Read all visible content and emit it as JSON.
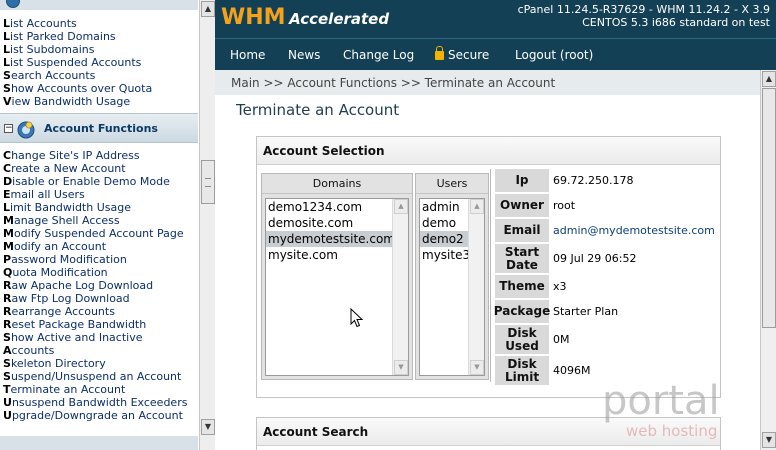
{
  "header": {
    "logo_whm": "WHM",
    "logo_accelerated": "Accelerated",
    "version_line1": "cPanel 11.24.5-R37629 - WHM 11.24.2 - X 3.9",
    "version_line2": "CENTOS 5.3 i686 standard on test"
  },
  "nav": {
    "home": "Home",
    "news": "News",
    "changelog": "Change Log",
    "secure": "Secure",
    "logout": "Logout (root)"
  },
  "sidebar": {
    "top_links": [
      "List Accounts",
      "List Parked Domains",
      "List Subdomains",
      "List Suspended Accounts",
      "Search Accounts",
      "Show Accounts over Quota",
      "View Bandwidth Usage"
    ],
    "section_title": "Account Functions",
    "section_toggle": "−",
    "section_links": [
      "Change Site's IP Address",
      "Create a New Account",
      "Disable or Enable Demo Mode",
      "Email all Users",
      "Limit Bandwidth Usage",
      "Manage Shell Access",
      "Modify Suspended Account Page",
      "Modify an Account",
      "Password Modification",
      "Quota Modification",
      "Raw Apache Log Download",
      "Raw Ftp Log Download",
      "Rearrange Accounts",
      "Reset Package Bandwidth",
      "Show Active and Inactive",
      "Accounts",
      "Skeleton Directory",
      "Suspend/Unsuspend an Account",
      "Terminate an Account",
      "Unsuspend Bandwidth Exceeders",
      "Upgrade/Downgrade an Account"
    ]
  },
  "main": {
    "breadcrumb": "Main >> Account Functions >> Terminate an Account",
    "page_title": "Terminate an Account",
    "selection_panel_title": "Account Selection",
    "domains_header": "Domains",
    "users_header": "Users",
    "domains": [
      "demo1234.com",
      "demosite.com",
      "mydemotestsite.com",
      "mysite.com"
    ],
    "users": [
      "admin",
      "demo",
      "demo2",
      "mysite3"
    ],
    "selected_index": 2,
    "info": {
      "ip_label": "Ip",
      "ip": "69.72.250.178",
      "owner_label": "Owner",
      "owner": "root",
      "email_label": "Email",
      "email": "admin@mydemotestsite.com",
      "start_label_1": "Start",
      "start_label_2": "Date",
      "start": "09 Jul 29 06:52",
      "theme_label": "Theme",
      "theme": "x3",
      "package_label": "Package",
      "package": "Starter Plan",
      "disk_used_label_1": "Disk",
      "disk_used_label_2": "Used",
      "disk_used": "0M",
      "disk_limit_label_1": "Disk",
      "disk_limit_label_2": "Limit",
      "disk_limit": "4096M"
    },
    "search_panel_title": "Account Search"
  },
  "watermark": {
    "brand": "portal",
    "tagline": "web hosting"
  },
  "colors": {
    "header_bg": "#134055",
    "logo_orange": "#f4a21b",
    "link_blue": "#0c2f6b",
    "selection_bg": "#c8cdd1"
  }
}
